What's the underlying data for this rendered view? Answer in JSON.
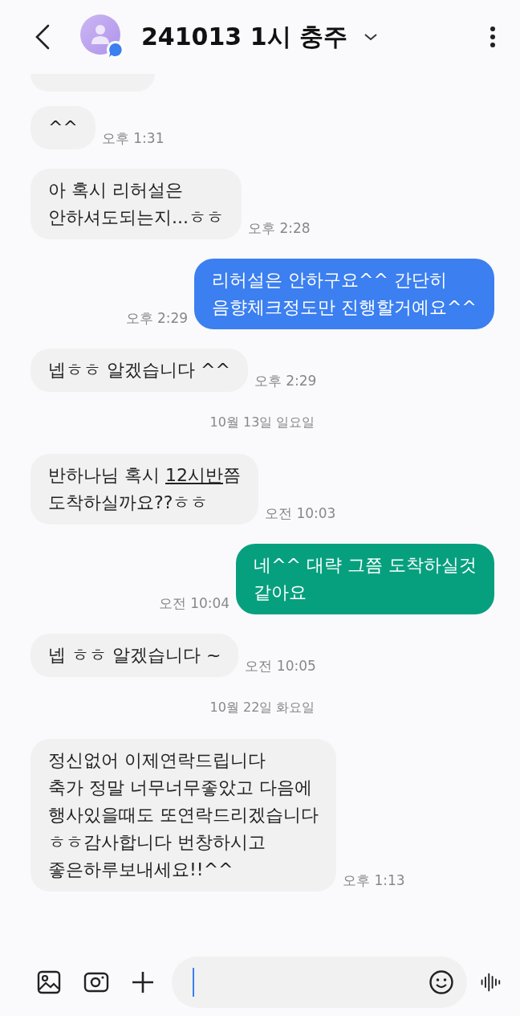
{
  "header": {
    "title": "241013 1시 충주"
  },
  "messages": [
    {
      "kind": "cut"
    },
    {
      "kind": "received",
      "segments": [
        {
          "text": "^^"
        }
      ],
      "time": "오후 1:31"
    },
    {
      "kind": "received",
      "segments": [
        {
          "text": "아 혹시 리허설은\n안하셔도되는지...ㅎㅎ"
        }
      ],
      "time": "오후 2:28"
    },
    {
      "kind": "sent",
      "color": "#3b7ff0",
      "segments": [
        {
          "text": "리허설은 안하구요^^ 간단히\n음향체크정도만 진행할거예요^^"
        }
      ],
      "time": "오후 2:29"
    },
    {
      "kind": "received",
      "segments": [
        {
          "text": "넵ㅎㅎ 알겠습니다 ^^"
        }
      ],
      "time": "오후 2:29"
    },
    {
      "kind": "date",
      "text": "10월 13일 일요일"
    },
    {
      "kind": "received",
      "segments": [
        {
          "text": "반하나님 혹시 "
        },
        {
          "text": "12시반",
          "link": true
        },
        {
          "text": "쯤\n도착하실까요??ㅎㅎ"
        }
      ],
      "time": "오전 10:03"
    },
    {
      "kind": "sent",
      "color": "#07a07f",
      "segments": [
        {
          "text": "네^^ 대략 그쯤 도착하실것\n같아요"
        }
      ],
      "time": "오전 10:04"
    },
    {
      "kind": "received",
      "segments": [
        {
          "text": "넵 ㅎㅎ 알겠습니다 ~"
        }
      ],
      "time": "오전 10:05"
    },
    {
      "kind": "date",
      "text": "10월 22일 화요일"
    },
    {
      "kind": "received",
      "segments": [
        {
          "text": "정신없어 이제연락드립니다\n축가 정말 너무너무좋았고 다음에\n행사있을때도 또연락드리겠습니다\nㅎㅎ감사합니다 번창하시고\n좋은하루보내세요!!^^"
        }
      ],
      "time": "오후 1:13"
    }
  ]
}
